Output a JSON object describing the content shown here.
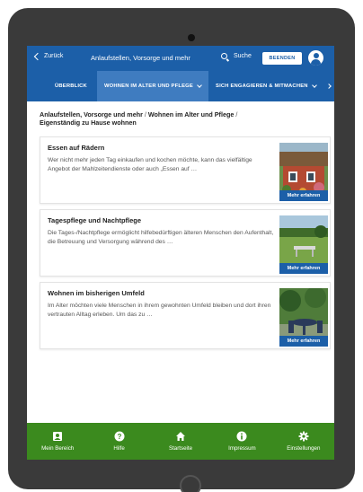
{
  "header": {
    "back_label": "Zurück",
    "title": "Anlaufstellen, Vorsorge und mehr",
    "search_label": "Suche",
    "end_label": "BEENDEN"
  },
  "tabs": [
    {
      "label": "ÜBERBLICK"
    },
    {
      "label": "WOHNEN IM ALTER UND PFLEGE",
      "active": true
    },
    {
      "label": "SICH ENGAGIEREN & MITMACHEN"
    }
  ],
  "breadcrumb": {
    "item1": "Anlaufstellen, Vorsorge und mehr",
    "item2": "Wohnen im Alter und Pflege",
    "item3": "Eigenständig zu Hause wohnen",
    "separator": "/"
  },
  "cards": [
    {
      "title": "Essen auf Rädern",
      "text": "Wer nicht mehr jeden Tag einkaufen und kochen möchte, kann das vielfältige Angebot der Mahlzeitendienste oder auch „Essen auf …",
      "button": "Mehr erfahren"
    },
    {
      "title": "Tagespflege und Nachtpflege",
      "text": "Die Tages-/Nachtpflege ermöglicht hilfebedürftigen älteren Menschen den Aufenthalt, die Betreuung und Versorgung während des …",
      "button": "Mehr erfahren"
    },
    {
      "title": "Wohnen im bisherigen Umfeld",
      "text": "Im Alter möchten viele Menschen in ihrem gewohnten Umfeld bleiben und dort ihren vertrauten Alltag erleben. Um das zu …",
      "button": "Mehr erfahren"
    }
  ],
  "bottom_nav": [
    {
      "label": "Mein Bereich",
      "icon": "badge-icon"
    },
    {
      "label": "Hilfe",
      "icon": "help-icon"
    },
    {
      "label": "Startseite",
      "icon": "home-icon"
    },
    {
      "label": "Impressum",
      "icon": "info-icon"
    },
    {
      "label": "Einstellungen",
      "icon": "gear-icon"
    }
  ],
  "colors": {
    "header_blue": "#1c5fa8",
    "active_tab": "#3f7cc0",
    "nav_green": "#3b8a1e",
    "device": "#3a3a3a"
  }
}
